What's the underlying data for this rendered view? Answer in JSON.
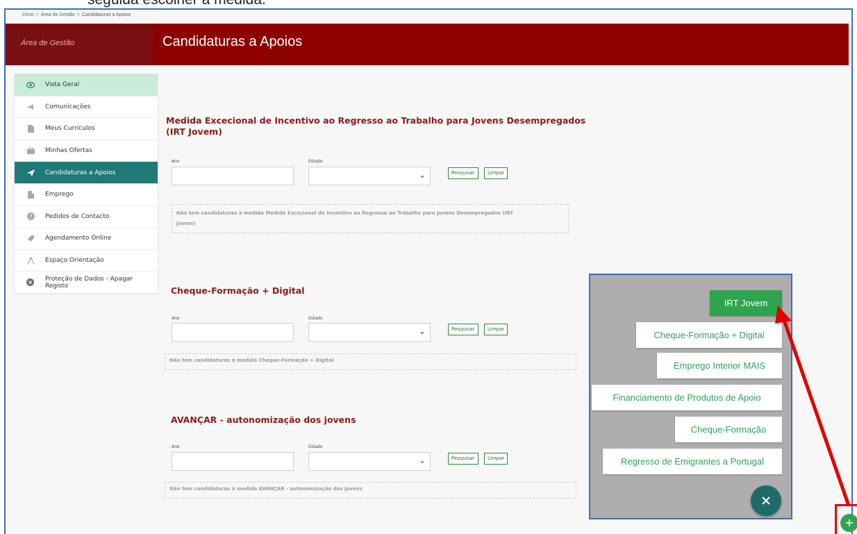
{
  "top_caption": "seguida escolher a medida.",
  "breadcrumb": [
    "Início",
    "Área de Gestão",
    "Candidaturas a Apoios"
  ],
  "header": {
    "left_label": "Área de Gestão",
    "title": "Candidaturas a Apoios",
    "bg_color": "#8c0000"
  },
  "sidebar": {
    "items": [
      {
        "label": "Vista Geral",
        "icon": "eye-icon",
        "state": "highlight"
      },
      {
        "label": "Comunicações",
        "icon": "megaphone-icon",
        "state": ""
      },
      {
        "label": "Meus Currículos",
        "icon": "document-icon",
        "state": ""
      },
      {
        "label": "Minhas Ofertas",
        "icon": "briefcase-icon",
        "state": ""
      },
      {
        "label": "Candidaturas a Apoios",
        "icon": "paper-plane-icon",
        "state": "active"
      },
      {
        "label": "Emprego",
        "icon": "building-icon",
        "state": ""
      },
      {
        "label": "Pedidos de Contacto",
        "icon": "question-circle-icon",
        "state": ""
      },
      {
        "label": "Agendamento Online",
        "icon": "tag-icon",
        "state": ""
      },
      {
        "label": "Espaço Orientação",
        "icon": "compass-icon",
        "state": ""
      },
      {
        "label": "Proteção de Dados - Apagar Registo",
        "icon": "close-circle-icon",
        "state": ""
      }
    ]
  },
  "sections": [
    {
      "title_line1": "Medida Excecional de Incentivo ao Regresso ao Trabalho para Jovens Desempregados",
      "title_line2": "(IRT Jovem)",
      "ano_label": "Ano",
      "ano_value": "",
      "estado_label": "Estado",
      "estado_value": "",
      "search_label": "Pesquisar",
      "clear_label": "Limpar",
      "notice_line1": "Não tem candidaturas à medida Medida Excecional de Incentivo ao Regresso ao Trabalho para Jovens Desempregados (IRT",
      "notice_line2": "Jovem)"
    },
    {
      "title_line1": "Cheque-Formação + Digital",
      "ano_label": "Ano",
      "ano_value": "",
      "estado_label": "Estado",
      "estado_value": "",
      "search_label": "Pesquisar",
      "clear_label": "Limpar",
      "notice_line1": "Não tem candidaturas à medida Cheque-Formação + Digital"
    },
    {
      "title_line1": "AVANÇAR - autonomização dos jovens",
      "ano_label": "Ano",
      "ano_value": "",
      "estado_label": "Estado",
      "estado_value": "",
      "search_label": "Pesquisar",
      "clear_label": "Limpar",
      "notice_line1": "Não tem candidaturas à medida AVANÇAR - autonomização dos jovens"
    }
  ],
  "popup_menu": {
    "items": [
      "IRT Jovem",
      "Cheque-Formação + Digital",
      "Emprego Interior MAIS",
      "Financiamento de Produtos de Apoio",
      "Cheque-Formação",
      "Regresso de Emigrantes a Portugal"
    ],
    "close_icon": "close-icon",
    "accent_color": "#2ea44f"
  },
  "fab": {
    "icon": "plus-icon"
  },
  "annotation": {
    "color": "#e00000"
  }
}
